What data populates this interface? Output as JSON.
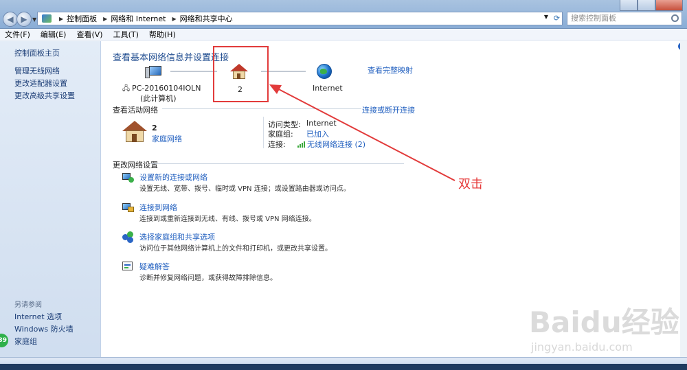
{
  "addressbar": {
    "breadcrumbs": [
      "控制面板",
      "网络和 Internet",
      "网络和共享中心"
    ]
  },
  "search": {
    "placeholder": "搜索控制面板"
  },
  "menu": [
    "文件(F)",
    "编辑(E)",
    "查看(V)",
    "工具(T)",
    "帮助(H)"
  ],
  "sidebar": {
    "home": "控制面板主页",
    "items": [
      "管理无线网络",
      "更改适配器设置",
      "更改高级共享设置"
    ],
    "see_also_header": "另请参阅",
    "see_also": [
      "Internet 选项",
      "Windows 防火墙",
      "家庭组"
    ],
    "badge": "39"
  },
  "main": {
    "title": "查看基本网络信息并设置连接",
    "full_map_link": "查看完整映射",
    "computer_name": "PC-20160104IOLN",
    "computer_sub": "(此计算机)",
    "network_name": "2",
    "internet_label": "Internet",
    "active_section": "查看活动网络",
    "connect_disconnect_link": "连接或断开连接",
    "active_network": {
      "name": "2",
      "type_link": "家庭网络",
      "access_type_label": "访问类型:",
      "access_type_value": "Internet",
      "homegroup_label": "家庭组:",
      "homegroup_value": "已加入",
      "connection_label": "连接:",
      "connection_value": "无线网络连接 (2)"
    },
    "change_section": "更改网络设置",
    "tasks": [
      {
        "title": "设置新的连接或网络",
        "desc": "设置无线、宽带、拨号、临时或 VPN 连接；或设置路由器或访问点。"
      },
      {
        "title": "连接到网络",
        "desc": "连接到或重新连接到无线、有线、拨号或 VPN 网络连接。"
      },
      {
        "title": "选择家庭组和共享选项",
        "desc": "访问位于其他网络计算机上的文件和打印机，或更改共享设置。"
      },
      {
        "title": "疑难解答",
        "desc": "诊断并修复网络问题，或获得故障排除信息。"
      }
    ]
  },
  "annotation": {
    "text": "双击"
  },
  "watermark": {
    "brand": "Baidu经验",
    "url": "jingyan.baidu.com"
  },
  "colors": {
    "accent": "#1f5ebf",
    "annotation": "#e23b3b",
    "sidebar_bg": "#dbe6f4"
  }
}
